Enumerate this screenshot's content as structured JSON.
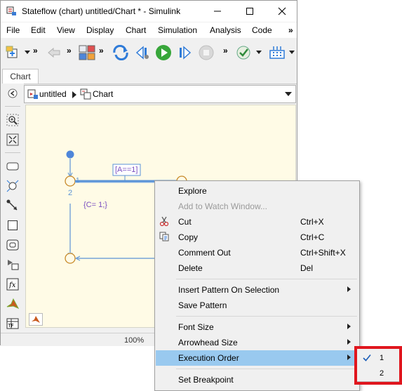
{
  "window": {
    "title": "Stateflow (chart) untitled/Chart * - Simulink"
  },
  "menubar": {
    "items": [
      "File",
      "Edit",
      "View",
      "Display",
      "Chart",
      "Simulation",
      "Analysis",
      "Code"
    ],
    "overflow": "»"
  },
  "toolbar": {
    "overflow_1": "»",
    "overflow_2": "»",
    "overflow_3": "»",
    "overflow_4": "»"
  },
  "tabs": {
    "active": "Chart"
  },
  "breadcrumb": {
    "model": "untitled",
    "chart": "Chart"
  },
  "chart": {
    "transition_label_top": "[A==1]",
    "transition_action": "{C= 1;}",
    "order_label_1": "1",
    "order_label_2": "2"
  },
  "status": {
    "zoom": "100%"
  },
  "context_menu": {
    "items": [
      {
        "label": "Explore",
        "shortcut": "",
        "disabled": false,
        "submenu": false
      },
      {
        "label": "Add to Watch Window...",
        "shortcut": "",
        "disabled": true,
        "submenu": false
      },
      {
        "label": "Cut",
        "shortcut": "Ctrl+X",
        "disabled": false,
        "submenu": false,
        "icon": "scissors-icon"
      },
      {
        "label": "Copy",
        "shortcut": "Ctrl+C",
        "disabled": false,
        "submenu": false,
        "icon": "copy-icon"
      },
      {
        "label": "Comment Out",
        "shortcut": "Ctrl+Shift+X",
        "disabled": false,
        "submenu": false
      },
      {
        "label": "Delete",
        "shortcut": "Del",
        "disabled": false,
        "submenu": false
      },
      {
        "label": "Insert Pattern On Selection",
        "shortcut": "",
        "disabled": false,
        "submenu": true
      },
      {
        "label": "Save Pattern",
        "shortcut": "",
        "disabled": false,
        "submenu": false
      },
      {
        "label": "Font Size",
        "shortcut": "",
        "disabled": false,
        "submenu": true
      },
      {
        "label": "Arrowhead Size",
        "shortcut": "",
        "disabled": false,
        "submenu": true
      },
      {
        "label": "Execution Order",
        "shortcut": "",
        "disabled": false,
        "submenu": true,
        "highlighted": true
      },
      {
        "label": "Set Breakpoint",
        "shortcut": "",
        "disabled": false,
        "submenu": false
      }
    ]
  },
  "execution_order_submenu": {
    "options": [
      "1",
      "2"
    ],
    "selected": "1"
  },
  "colors": {
    "canvas_bg": "#fffbe6",
    "state_stroke": "#c88a2a",
    "transition": "#5b93d6",
    "highlight": "#99c9ef",
    "annotation_box": "#e0161e",
    "label_text": "#7a4fc0"
  }
}
